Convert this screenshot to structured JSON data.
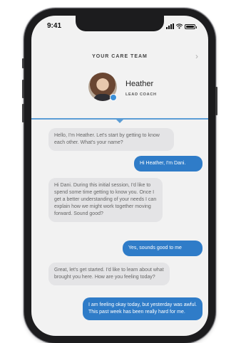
{
  "status_bar": {
    "time": "9:41"
  },
  "header": {
    "title": "YOUR CARE TEAM"
  },
  "coach": {
    "name": "Heather",
    "role": "LEAD COACH"
  },
  "messages": [
    {
      "sender": "coach",
      "text": "Hello, I'm Heather. Let's start by getting to know each other. What's your name?"
    },
    {
      "sender": "user",
      "text": "Hi Heather, I'm Dani."
    },
    {
      "sender": "coach",
      "text": "Hi Dani. During this initial session, I'd like to spend some time getting to know you. Once I get a better understanding of your needs I can explain how we might work together moving forward. Sound good?"
    },
    {
      "sender": "user",
      "text": "Yes, sounds good to me"
    },
    {
      "sender": "coach",
      "text": "Great, let's get started. I'd like to learn about what brought you here. How are you feeling today?"
    },
    {
      "sender": "user",
      "text": "I am feeling okay today, but yesterday was awful. This past week has been really hard for me."
    }
  ],
  "colors": {
    "accent": "#2f7cc8",
    "divider": "#5b9dd6",
    "incoming_bubble": "#e4e4e6"
  },
  "icons": [
    "signal-icon",
    "wifi-icon",
    "battery-icon",
    "chevron-right-icon",
    "verified-badge-icon"
  ]
}
